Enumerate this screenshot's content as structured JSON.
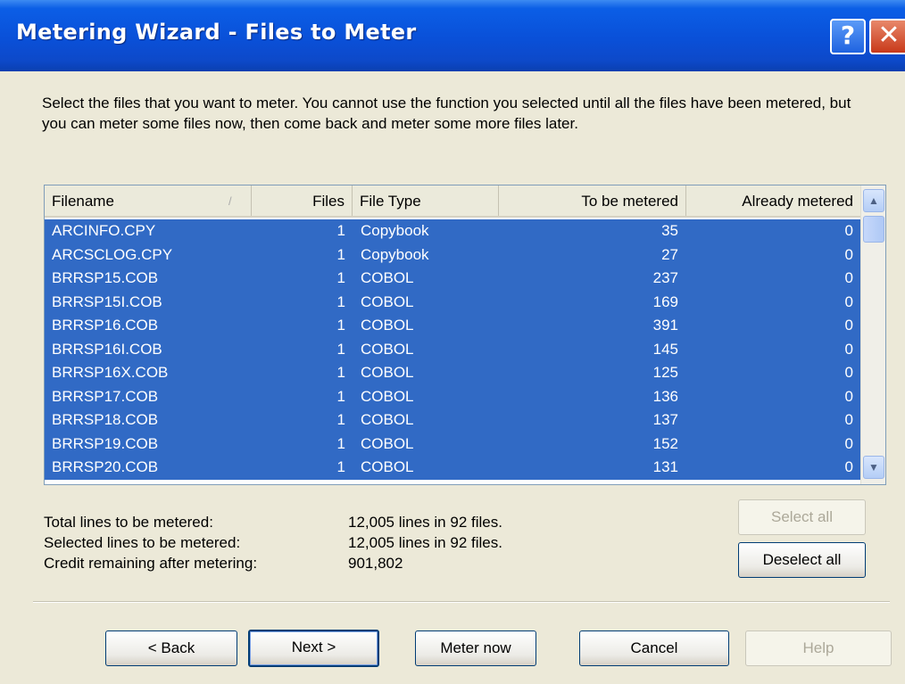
{
  "window": {
    "title": "Metering Wizard - Files to Meter",
    "help_glyph": "?",
    "close_glyph": "✕"
  },
  "description": "Select the files that you want to meter. You cannot use the function you selected until all the files have been metered, but you can meter some files now, then come back and meter some more files later.",
  "table": {
    "columns": {
      "filename": "Filename",
      "files": "Files",
      "file_type": "File Type",
      "to_be_metered": "To be metered",
      "already_metered": "Already metered"
    },
    "rows": [
      {
        "filename": "ARCINFO.CPY",
        "files": "1",
        "file_type": "Copybook",
        "to_be_metered": "35",
        "already_metered": "0"
      },
      {
        "filename": "ARCSCLOG.CPY",
        "files": "1",
        "file_type": "Copybook",
        "to_be_metered": "27",
        "already_metered": "0"
      },
      {
        "filename": "BRRSP15.COB",
        "files": "1",
        "file_type": "COBOL",
        "to_be_metered": "237",
        "already_metered": "0"
      },
      {
        "filename": "BRRSP15I.COB",
        "files": "1",
        "file_type": "COBOL",
        "to_be_metered": "169",
        "already_metered": "0"
      },
      {
        "filename": "BRRSP16.COB",
        "files": "1",
        "file_type": "COBOL",
        "to_be_metered": "391",
        "already_metered": "0"
      },
      {
        "filename": "BRRSP16I.COB",
        "files": "1",
        "file_type": "COBOL",
        "to_be_metered": "145",
        "already_metered": "0"
      },
      {
        "filename": "BRRSP16X.COB",
        "files": "1",
        "file_type": "COBOL",
        "to_be_metered": "125",
        "already_metered": "0"
      },
      {
        "filename": "BRRSP17.COB",
        "files": "1",
        "file_type": "COBOL",
        "to_be_metered": "136",
        "already_metered": "0"
      },
      {
        "filename": "BRRSP18.COB",
        "files": "1",
        "file_type": "COBOL",
        "to_be_metered": "137",
        "already_metered": "0"
      },
      {
        "filename": "BRRSP19.COB",
        "files": "1",
        "file_type": "COBOL",
        "to_be_metered": "152",
        "already_metered": "0"
      },
      {
        "filename": "BRRSP20.COB",
        "files": "1",
        "file_type": "COBOL",
        "to_be_metered": "131",
        "already_metered": "0"
      }
    ],
    "selection_color": "#316ac5"
  },
  "stats": {
    "total_label": "Total lines to be metered:",
    "total_value": "12,005 lines in 92 files.",
    "selected_label": "Selected lines to be metered:",
    "selected_value": "12,005 lines in 92 files.",
    "credit_label": "Credit remaining after metering:",
    "credit_value": "901,802"
  },
  "buttons": {
    "select_all": "Select all",
    "deselect_all": "Deselect all",
    "back": "< Back",
    "next": "Next >",
    "meter_now": "Meter now",
    "cancel": "Cancel",
    "help": "Help"
  },
  "icons": {
    "scroll_up": "chevron-up-icon",
    "scroll_down": "chevron-down-icon"
  }
}
